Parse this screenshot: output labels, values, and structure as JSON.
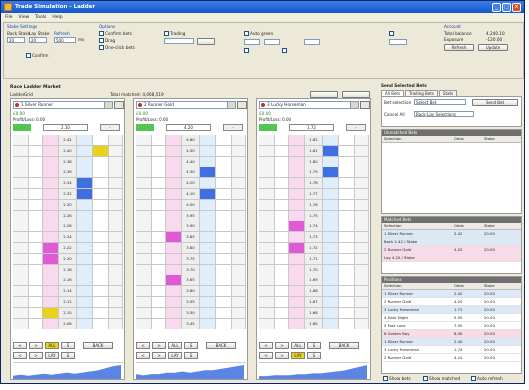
{
  "window": {
    "title": "Trade Simulation - Ladder"
  },
  "menu": [
    "File",
    "View",
    "Tools",
    "Help"
  ],
  "settings": {
    "stake_group": "Stake Settings",
    "fields": [
      {
        "label": "Back Stake",
        "value": "20"
      },
      {
        "label": "Lay Stake",
        "value": "20"
      },
      {
        "label": "Refresh",
        "value": "500"
      }
    ],
    "checks": [
      "Confirm",
      "Confirm bets",
      "Drag",
      "One-click bets",
      "Trading",
      "Auto green"
    ],
    "options_group": "Options",
    "refresh_unit": "ms",
    "account_group": "Account",
    "account": [
      {
        "label": "Total balance",
        "value": "4,240.10"
      },
      {
        "label": "Exposure",
        "value": "-120.00"
      }
    ],
    "buttons": [
      "Refresh",
      "Update"
    ]
  },
  "ladder_section": {
    "title": "Race Ladder Market",
    "tabs": [
      "Ladder",
      "Grid"
    ],
    "total_matched": "Total matched: 4,068,519"
  },
  "ladders": [
    {
      "runner": "1 Silver Runner",
      "pl": "£0.00",
      "ptxt": "Profit/Loss: 0.00",
      "last": "2.10",
      "spread": "-",
      "rows": [
        {
          "bk": "",
          "price": "2.42",
          "lay": "",
          "hl": ""
        },
        {
          "bk": "",
          "price": "2.40",
          "lay": "",
          "hl": "y"
        },
        {
          "bk": "",
          "price": "2.38",
          "lay": "",
          "hl": ""
        },
        {
          "bk": "",
          "price": "2.36",
          "lay": "",
          "hl": ""
        },
        {
          "bk": "",
          "price": "2.34",
          "lay": "",
          "hl": "b"
        },
        {
          "bk": "",
          "price": "2.32",
          "lay": "",
          "hl": "b"
        },
        {
          "bk": "",
          "price": "2.30",
          "lay": "",
          "hl": ""
        },
        {
          "bk": "",
          "price": "2.28",
          "lay": "",
          "hl": ""
        },
        {
          "bk": "",
          "price": "2.26",
          "lay": "",
          "hl": ""
        },
        {
          "bk": "",
          "price": "2.24",
          "lay": "",
          "hl": ""
        },
        {
          "bk": "",
          "price": "2.22",
          "lay": "",
          "hl": "m"
        },
        {
          "bk": "",
          "price": "2.20",
          "lay": "",
          "hl": "m"
        },
        {
          "bk": "",
          "price": "2.18",
          "lay": "",
          "hl": ""
        },
        {
          "bk": "",
          "price": "2.16",
          "lay": "",
          "hl": ""
        },
        {
          "bk": "",
          "price": "2.14",
          "lay": "",
          "hl": ""
        },
        {
          "bk": "",
          "price": "2.12",
          "lay": "",
          "hl": ""
        },
        {
          "bk": "",
          "price": "2.10",
          "lay": "",
          "hl": "y2"
        },
        {
          "bk": "",
          "price": "2.08",
          "lay": "",
          "hl": ""
        }
      ],
      "bottom": [
        "<",
        ">",
        "ALL",
        "S",
        "BACK",
        "LAY"
      ],
      "spark": [
        2,
        3,
        2,
        3,
        4,
        3,
        4,
        5,
        4,
        5,
        6,
        7,
        9,
        11,
        12
      ]
    },
    {
      "runner": "2 Runner Gold",
      "pl": "£0.00",
      "ptxt": "Profit/Loss: 0.00",
      "last": "4.20",
      "spread": "-",
      "rows": [
        {
          "bk": "",
          "price": "4.60",
          "lay": "",
          "hl": ""
        },
        {
          "bk": "",
          "price": "4.50",
          "lay": "",
          "hl": ""
        },
        {
          "bk": "",
          "price": "4.40",
          "lay": "",
          "hl": ""
        },
        {
          "bk": "",
          "price": "4.30",
          "lay": "",
          "hl": "b"
        },
        {
          "bk": "",
          "price": "4.20",
          "lay": "",
          "hl": ""
        },
        {
          "bk": "",
          "price": "4.10",
          "lay": "",
          "hl": "b"
        },
        {
          "bk": "",
          "price": "4.00",
          "lay": "",
          "hl": ""
        },
        {
          "bk": "",
          "price": "3.95",
          "lay": "",
          "hl": ""
        },
        {
          "bk": "",
          "price": "3.90",
          "lay": "",
          "hl": ""
        },
        {
          "bk": "",
          "price": "3.85",
          "lay": "",
          "hl": "m"
        },
        {
          "bk": "",
          "price": "3.80",
          "lay": "",
          "hl": ""
        },
        {
          "bk": "",
          "price": "3.75",
          "lay": "",
          "hl": ""
        },
        {
          "bk": "",
          "price": "3.70",
          "lay": "",
          "hl": ""
        },
        {
          "bk": "",
          "price": "3.65",
          "lay": "",
          "hl": "m"
        },
        {
          "bk": "",
          "price": "3.60",
          "lay": "",
          "hl": ""
        },
        {
          "bk": "",
          "price": "3.55",
          "lay": "",
          "hl": ""
        },
        {
          "bk": "",
          "price": "3.50",
          "lay": "",
          "hl": ""
        },
        {
          "bk": "",
          "price": "3.45",
          "lay": "",
          "hl": ""
        }
      ],
      "bottom": [
        "<",
        ">",
        "ALL",
        "S",
        "BACK",
        "LAY"
      ],
      "spark": [
        3,
        2,
        3,
        3,
        4,
        4,
        5,
        4,
        5,
        6,
        6,
        7,
        8,
        9,
        10
      ]
    },
    {
      "runner": "3 Lucky Horseman",
      "pl": "£0.00",
      "ptxt": "Profit/Loss: 0.00",
      "last": "1.72",
      "spread": "-",
      "rows": [
        {
          "bk": "",
          "price": "1.82",
          "lay": "",
          "hl": ""
        },
        {
          "bk": "",
          "price": "1.81",
          "lay": "",
          "hl": "b"
        },
        {
          "bk": "",
          "price": "1.80",
          "lay": "",
          "hl": ""
        },
        {
          "bk": "",
          "price": "1.79",
          "lay": "",
          "hl": "b"
        },
        {
          "bk": "",
          "price": "1.78",
          "lay": "",
          "hl": ""
        },
        {
          "bk": "",
          "price": "1.77",
          "lay": "",
          "hl": ""
        },
        {
          "bk": "",
          "price": "1.76",
          "lay": "",
          "hl": ""
        },
        {
          "bk": "",
          "price": "1.75",
          "lay": "",
          "hl": ""
        },
        {
          "bk": "",
          "price": "1.74",
          "lay": "",
          "hl": "m"
        },
        {
          "bk": "",
          "price": "1.73",
          "lay": "",
          "hl": ""
        },
        {
          "bk": "",
          "price": "1.72",
          "lay": "",
          "hl": "m"
        },
        {
          "bk": "",
          "price": "1.71",
          "lay": "",
          "hl": ""
        },
        {
          "bk": "",
          "price": "1.70",
          "lay": "",
          "hl": ""
        },
        {
          "bk": "",
          "price": "1.69",
          "lay": "",
          "hl": ""
        },
        {
          "bk": "",
          "price": "1.68",
          "lay": "",
          "hl": ""
        },
        {
          "bk": "",
          "price": "1.67",
          "lay": "",
          "hl": ""
        },
        {
          "bk": "",
          "price": "1.66",
          "lay": "",
          "hl": ""
        },
        {
          "bk": "",
          "price": "1.65",
          "lay": "",
          "hl": ""
        }
      ],
      "bottom": [
        "<",
        ">",
        "ALL",
        "S",
        "BACK",
        "LAY"
      ],
      "spark": [
        2,
        2,
        3,
        3,
        3,
        4,
        4,
        5,
        5,
        6,
        7,
        8,
        10,
        12,
        14
      ]
    }
  ],
  "right": {
    "title": "Send Selected Bets",
    "tabs": [
      "All Bets",
      "Trading Bets",
      "Stats"
    ],
    "filter_label": "Bet selection",
    "filter_value": "Select Bet",
    "send_button": "Send Bet",
    "cancel_label": "Cancel All",
    "cancel_value": "Back-Lay Selections",
    "unmatched_header": "Unmatched Bets",
    "unmatched_cols": [
      "Selection",
      "Odds",
      "Stake"
    ],
    "matched_header": "Matched Bets",
    "matched_cols": [
      "Selection",
      "Odds",
      "Stake"
    ],
    "matched_rows": [
      {
        "sel": "1 Silver Runner",
        "odds": "2.42",
        "stake": "20.00",
        "c": "blue"
      },
      {
        "sel": "Back 2.42 / Stake",
        "odds": "",
        "stake": "",
        "c": "blue"
      },
      {
        "sel": "2 Runner Gold",
        "odds": "4.20",
        "stake": "20.00",
        "c": "pink"
      },
      {
        "sel": "Lay 4.20 / Stake",
        "odds": "",
        "stake": "",
        "c": "pink"
      }
    ],
    "positions_header": "Positions",
    "positions_cols": [
      "Selection",
      "Odds",
      "Stake"
    ],
    "positions_rows": [
      {
        "sel": "1 Silver Runner",
        "odds": "2.42",
        "stake": "20.00",
        "c": "blue"
      },
      {
        "sel": "2 Runner Gold",
        "odds": "4.20",
        "stake": "20.00",
        "c": ""
      },
      {
        "sel": "3 Lucky Horseman",
        "odds": "1.72",
        "stake": "20.00",
        "c": "blue"
      },
      {
        "sel": "4 Dark Night",
        "odds": "5.50",
        "stake": "20.00",
        "c": ""
      },
      {
        "sel": "5 Fast Lane",
        "odds": "7.00",
        "stake": "20.00",
        "c": ""
      },
      {
        "sel": "6 Golden Boy",
        "odds": "8.40",
        "stake": "20.00",
        "c": "pink"
      },
      {
        "sel": "1 Silver Runner",
        "odds": "2.40",
        "stake": "20.00",
        "c": "blue"
      },
      {
        "sel": "3 Lucky Horseman",
        "odds": "1.74",
        "stake": "20.00",
        "c": ""
      },
      {
        "sel": "2 Runner Gold",
        "odds": "4.10",
        "stake": "20.00",
        "c": ""
      }
    ],
    "footer_checks": [
      "Show bets",
      "Show matched",
      "Auto refresh"
    ]
  },
  "colors": {
    "titlebar": "#1556c9",
    "green": "#52c552",
    "back": "#f9d9ee",
    "lay": "#dfeefa",
    "highlight_yellow": "#e8d21a",
    "highlight_blue": "#3f6fe0",
    "highlight_magenta": "#e05ad6"
  }
}
